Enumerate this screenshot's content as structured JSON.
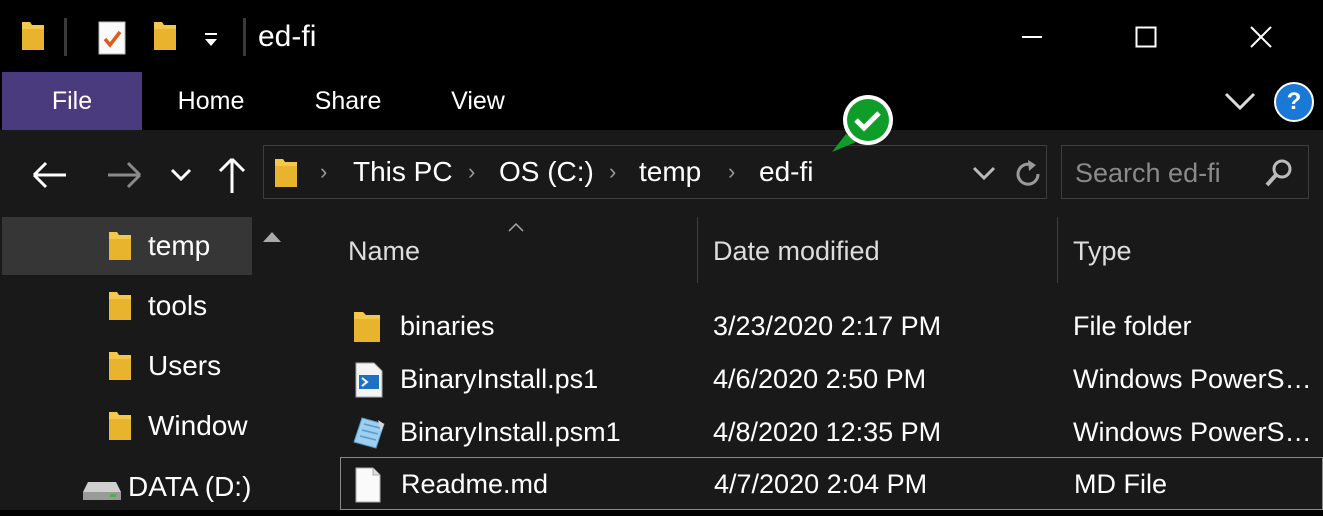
{
  "window": {
    "title": "ed-fi"
  },
  "ribbon": {
    "tabs": [
      {
        "label": "File"
      },
      {
        "label": "Home"
      },
      {
        "label": "Share"
      },
      {
        "label": "View"
      }
    ],
    "help": "?"
  },
  "address": {
    "crumbs": [
      "This PC",
      "OS (C:)",
      "temp",
      "ed-fi"
    ]
  },
  "search": {
    "placeholder": "Search ed-fi"
  },
  "tree": {
    "items": [
      {
        "label": "temp",
        "icon": "folder-icon",
        "selected": true
      },
      {
        "label": "tools",
        "icon": "folder-icon"
      },
      {
        "label": "Users",
        "icon": "folder-icon"
      },
      {
        "label": "Window",
        "icon": "folder-icon"
      },
      {
        "label": "DATA (D:)",
        "icon": "drive-icon"
      }
    ]
  },
  "columns": {
    "name": "Name",
    "date": "Date modified",
    "type": "Type"
  },
  "files": [
    {
      "name": "binaries",
      "date": "3/23/2020 2:17 PM",
      "type": "File folder",
      "icon": "folder-icon"
    },
    {
      "name": "BinaryInstall.ps1",
      "date": "4/6/2020 2:50 PM",
      "type": "Windows PowerS…",
      "icon": "powershell-script-icon"
    },
    {
      "name": "BinaryInstall.psm1",
      "date": "4/8/2020 12:35 PM",
      "type": "Windows PowerS…",
      "icon": "powershell-module-icon"
    },
    {
      "name": "Readme.md",
      "date": "4/7/2020 2:04 PM",
      "type": "MD File",
      "icon": "document-icon"
    }
  ],
  "colors": {
    "file_tab": "#4a3a7e",
    "folder": "#f4c84a",
    "sync_badge": "#0f9d2a",
    "help": "#1a78d6"
  }
}
